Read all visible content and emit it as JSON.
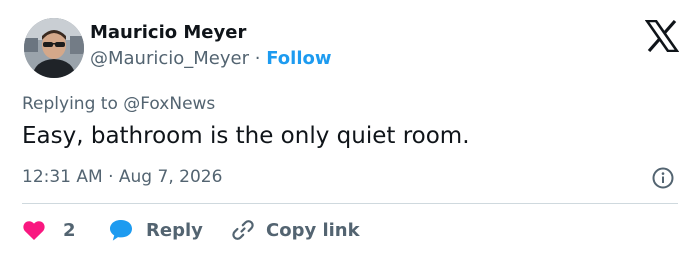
{
  "author": {
    "name": "Mauricio Meyer",
    "handle": "@Mauricio_Meyer",
    "separator": "·",
    "follow_label": "Follow"
  },
  "tweet": {
    "replying_to": "Replying to @FoxNews",
    "text": "Easy, bathroom is the only quiet room.",
    "timestamp": "12:31 AM · Aug 7, 2026"
  },
  "actions": {
    "like_count": "2",
    "reply_label": "Reply",
    "copy_link_label": "Copy link"
  },
  "colors": {
    "accent": "#1d9bf0",
    "like": "#f91880",
    "secondary_text": "#536471",
    "primary_text": "#0f1419",
    "divider": "#cfd9de"
  },
  "icons": [
    "x-logo-icon",
    "info-icon",
    "heart-icon",
    "speech-bubble-icon",
    "link-icon"
  ]
}
